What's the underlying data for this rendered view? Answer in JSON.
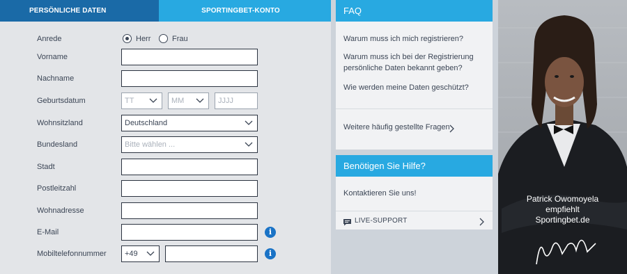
{
  "steps": {
    "step1": "PERSÖNLICHE DATEN",
    "step2": "SPORTINGBET-KONTO"
  },
  "form": {
    "anrede": {
      "label": "Anrede",
      "options": [
        "Herr",
        "Frau"
      ],
      "selected": "Herr"
    },
    "vorname": {
      "label": "Vorname",
      "value": ""
    },
    "nachname": {
      "label": "Nachname",
      "value": ""
    },
    "geburtsdatum": {
      "label": "Geburtsdatum",
      "day_placeholder": "TT",
      "month_placeholder": "MM",
      "year_placeholder": "JJJJ"
    },
    "wohnsitzland": {
      "label": "Wohnsitzland",
      "value": "Deutschland"
    },
    "bundesland": {
      "label": "Bundesland",
      "placeholder": "Bitte wählen ..."
    },
    "stadt": {
      "label": "Stadt",
      "value": ""
    },
    "postleitzahl": {
      "label": "Postleitzahl",
      "value": ""
    },
    "wohnadresse": {
      "label": "Wohnadresse",
      "value": ""
    },
    "email": {
      "label": "E-Mail",
      "value": ""
    },
    "mobil": {
      "label": "Mobiltelefonnummer",
      "prefix": "+49",
      "value": ""
    }
  },
  "faq": {
    "title": "FAQ",
    "items": [
      "Warum muss ich mich registrieren?",
      "Warum muss ich bei der Registrierung persönliche Daten bekannt geben?",
      "Wie werden meine Daten geschützt?"
    ],
    "more": "Weitere häufig gestellte Fragen"
  },
  "help": {
    "title": "Benötigen Sie Hilfe?",
    "contact": "Kontaktieren Sie uns!",
    "live_support": "LIVE-SUPPORT"
  },
  "endorsement": {
    "line1": "Patrick Owomoyela",
    "line2": "empfiehlt",
    "line3": "Sportingbet.de",
    "signature": "Patrick Owomoyela"
  },
  "colors": {
    "accent": "#28a9e1",
    "step_active": "#1a6aa7",
    "info_icon": "#1a73c6"
  }
}
